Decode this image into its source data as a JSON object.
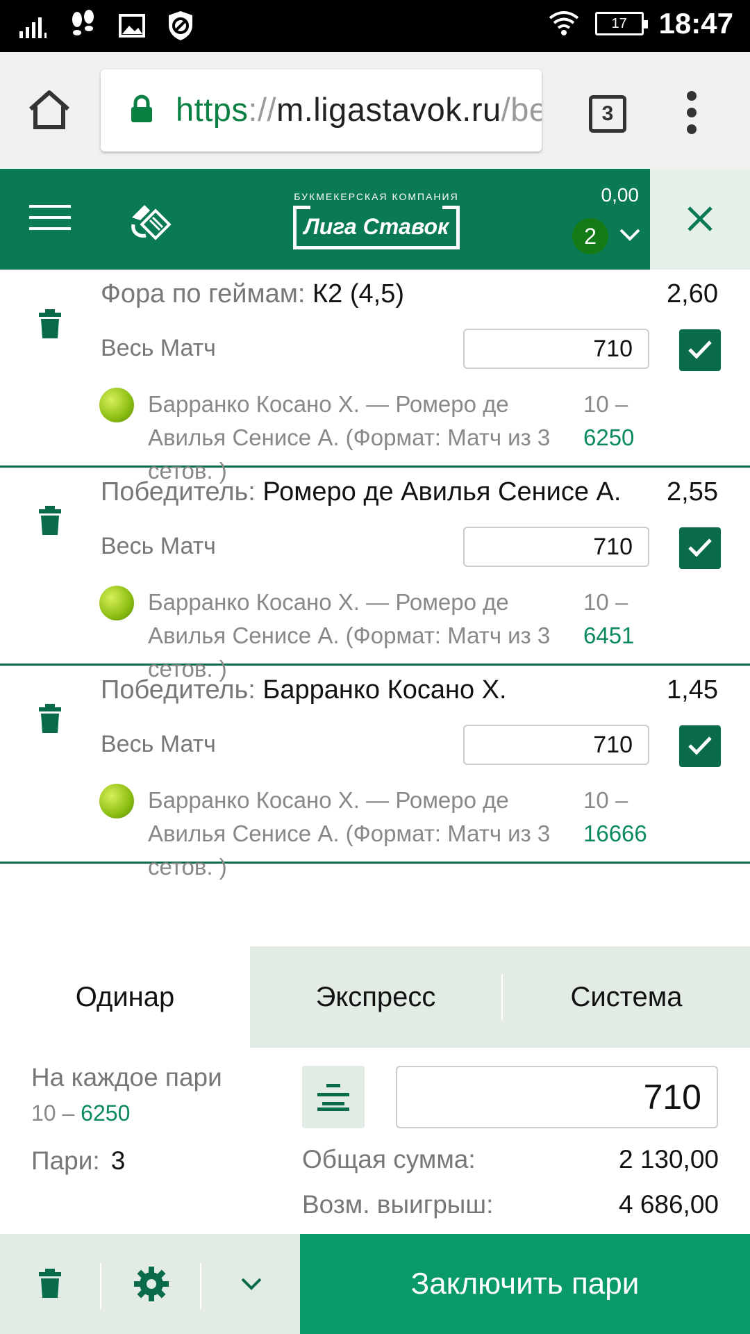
{
  "status_bar": {
    "time": "18:47",
    "battery": "17",
    "icons": [
      "signal-icon",
      "steps-icon",
      "image-icon",
      "shield-block-icon",
      "wifi-icon",
      "battery-icon"
    ]
  },
  "browser": {
    "url_scheme": "https",
    "url_sep": "://",
    "url_host": "m.ligastavok.ru",
    "url_path": "/bet",
    "tab_count": "3"
  },
  "header": {
    "logo_subtitle": "БУКМЕКЕРСКАЯ КОМПАНИЯ",
    "logo_title": "Лига Ставок",
    "balance": "0,00",
    "bet_count": "2",
    "accent": "#0a7a55"
  },
  "bets": [
    {
      "market_label": "Фора по геймам: ",
      "selection": "К2 (4,5)",
      "odds": "2,60",
      "period": "Весь Матч",
      "stake": "710",
      "event": "Барранко Косано Х. — Ромеро де Авилья Сенисе А. (Формат: Матч из 3 сетов. )",
      "min": "10 –",
      "max": "6250"
    },
    {
      "market_label": "Победитель: ",
      "selection": "Ромеро де Авилья Сенисе А.",
      "odds": "2,55",
      "period": "Весь Матч",
      "stake": "710",
      "event": "Барранко Косано Х. — Ромеро де Авилья Сенисе А. (Формат: Матч из 3 сетов. )",
      "min": "10 –",
      "max": "6451"
    },
    {
      "market_label": "Победитель: ",
      "selection": "Барранко Косано Х.",
      "odds": "1,45",
      "period": "Весь Матч",
      "stake": "710",
      "event": "Барранко Косано Х. — Ромеро де Авилья Сенисе А. (Формат: Матч из 3 сетов. )",
      "min": "10 –",
      "max": "16666"
    }
  ],
  "tabs": [
    "Одинар",
    "Экспресс",
    "Система"
  ],
  "summary": {
    "each_label": "На каждое пари",
    "each_min": "10 –",
    "each_max": "6250",
    "count_label": "Пари:",
    "count_value": "3",
    "stake_value": "710",
    "total_label": "Общая сумма:",
    "total_value": "2 130,00",
    "win_label": "Возм. выигрыш:",
    "win_value": "4 686,00"
  },
  "footer": {
    "submit_label": "Заключить пари"
  }
}
